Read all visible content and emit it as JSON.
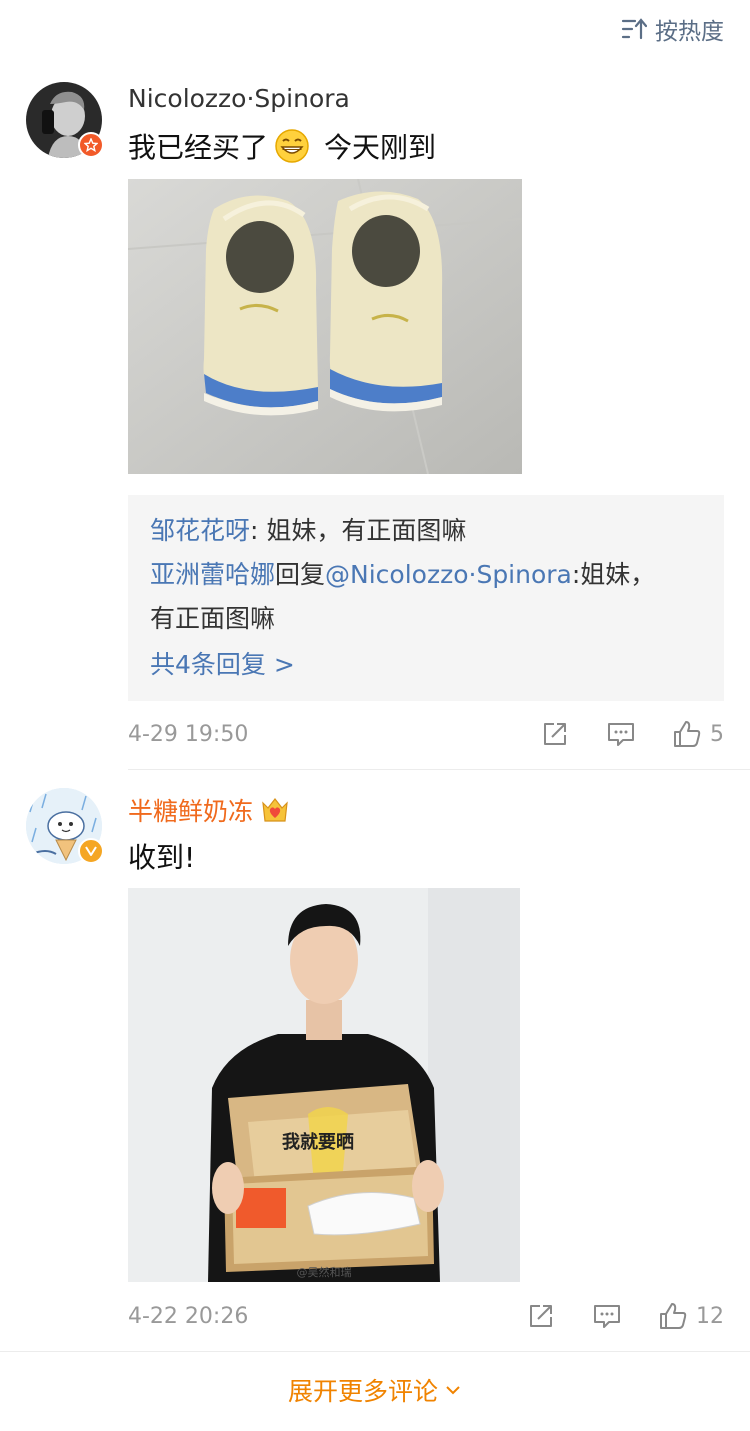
{
  "sort": {
    "label": "按热度",
    "icon": "sort-icon"
  },
  "comments": [
    {
      "user": "Nicolozzo·Spinora",
      "text_before": "我已经买了",
      "text_after": "今天刚到",
      "emoji": "grin-emoji",
      "replies": [
        {
          "user": "邹花花呀",
          "text": ": 姐妹，有正面图嘛"
        },
        {
          "user": "亚洲蕾哈娜",
          "mid": "回复",
          "mention": "@Nicolozzo·Spinora",
          "text1": ":姐妹，",
          "text2": "有正面图嘛"
        }
      ],
      "more_replies": "共4条回复 >",
      "time": "4-29 19:50",
      "likes": "5"
    },
    {
      "user": "半糖鲜奶冻",
      "text": "收到!",
      "badge": "verified-v",
      "image_text": "我就要晒",
      "watermark": "@吴然和瑞",
      "time": "4-22 20:26",
      "likes": "12"
    }
  ],
  "expand": {
    "label": "展开更多评论"
  },
  "colors": {
    "link": "#4a77b4",
    "accent": "#f08300",
    "muted": "#999999",
    "vip_name": "#f06a1d"
  }
}
